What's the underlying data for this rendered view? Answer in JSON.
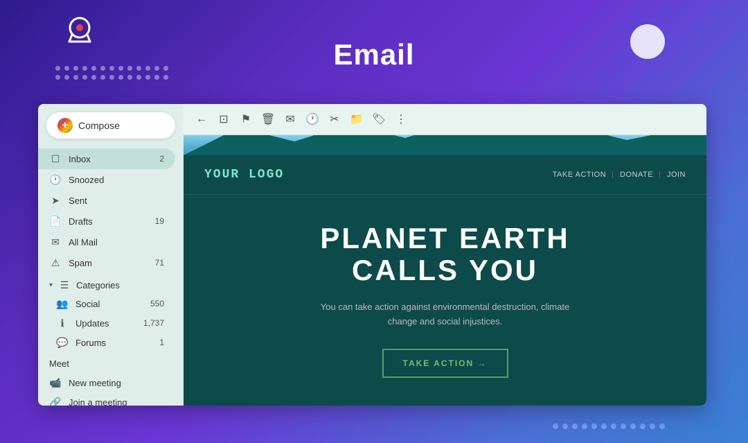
{
  "page": {
    "title": "Email",
    "background": "gradient-purple-blue"
  },
  "decorations": {
    "dots_rows": 2,
    "dots_per_row": 13,
    "bottom_dots": 12
  },
  "sidebar": {
    "compose_label": "Compose",
    "items": [
      {
        "id": "inbox",
        "label": "Inbox",
        "badge": "2",
        "active": true,
        "icon": "inbox"
      },
      {
        "id": "snoozed",
        "label": "Snoozed",
        "badge": "",
        "active": false,
        "icon": "clock"
      },
      {
        "id": "sent",
        "label": "Sent",
        "badge": "",
        "active": false,
        "icon": "send"
      },
      {
        "id": "drafts",
        "label": "Drafts",
        "badge": "19",
        "active": false,
        "icon": "draft"
      },
      {
        "id": "all-mail",
        "label": "All Mail",
        "badge": "",
        "active": false,
        "icon": "mail"
      },
      {
        "id": "spam",
        "label": "Spam",
        "badge": "71",
        "active": false,
        "icon": "warning"
      }
    ],
    "categories_label": "Categories",
    "categories": [
      {
        "id": "social",
        "label": "Social",
        "badge": "550",
        "icon": "people"
      },
      {
        "id": "updates",
        "label": "Updates",
        "badge": "1,737",
        "icon": "info"
      },
      {
        "id": "forums",
        "label": "Forums",
        "badge": "1",
        "icon": "chat"
      }
    ],
    "meet_label": "Meet",
    "meet_items": [
      {
        "id": "new-meeting",
        "label": "New meeting",
        "icon": "video"
      },
      {
        "id": "join-meeting",
        "label": "Join a meeting",
        "icon": "join"
      }
    ]
  },
  "toolbar": {
    "icons": [
      "back",
      "archive",
      "info",
      "delete",
      "move",
      "clock",
      "tag",
      "folder",
      "label",
      "more"
    ]
  },
  "newsletter": {
    "logo": "YOUR LOGO",
    "nav_items": [
      "TAKE ACTION",
      "DONATE",
      "JOIN"
    ],
    "headline_line1": "PLANET EARTH",
    "headline_line2": "CALLS YOU",
    "subtext": "You can take action against environmental destruction, climate change and social injustices.",
    "cta_label": "TAKE ACTION →"
  }
}
